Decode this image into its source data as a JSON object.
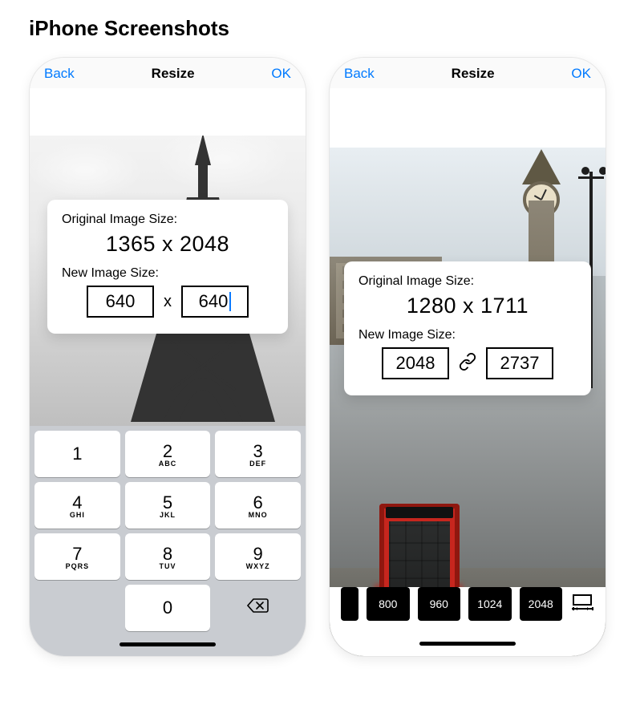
{
  "page_title": "iPhone Screenshots",
  "ios_accent": "#007aff",
  "nav": {
    "back": "Back",
    "title": "Resize",
    "ok": "OK"
  },
  "s1": {
    "orig_label": "Original Image Size:",
    "orig_value": "1365 x 2048",
    "new_label": "New Image Size:",
    "width": "640",
    "height": "640",
    "x": "x"
  },
  "keypad": {
    "k1": "1",
    "k2": "2",
    "k3": "3",
    "k4": "4",
    "k5": "5",
    "k6": "6",
    "k7": "7",
    "k8": "8",
    "k9": "9",
    "k0": "0",
    "s2": "ABC",
    "s3": "DEF",
    "s4": "GHI",
    "s5": "JKL",
    "s6": "MNO",
    "s7": "PQRS",
    "s8": "TUV",
    "s9": "WXYZ"
  },
  "s2": {
    "orig_label": "Original Image Size:",
    "orig_value": "1280 x 1711",
    "new_label": "New Image Size:",
    "width": "2048",
    "height": "2737",
    "presets": [
      "800",
      "960",
      "1024",
      "2048"
    ]
  }
}
